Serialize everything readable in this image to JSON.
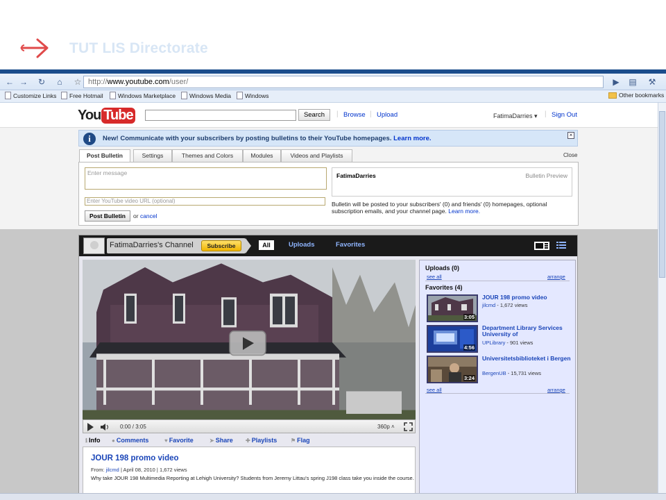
{
  "slide": {
    "title": "TUT LIS Directorate"
  },
  "browser": {
    "url_prefix": "http://",
    "url_domain": "www.youtube.com",
    "url_path": "/user/",
    "bookmarks": [
      "Customize Links",
      "Free Hotmail",
      "Windows Marketplace",
      "Windows Media",
      "Windows"
    ],
    "other_bookmarks": "Other bookmarks"
  },
  "yt": {
    "logo_you": "You",
    "logo_tube": "Tube",
    "search_label": "Search",
    "browse": "Browse",
    "upload": "Upload",
    "username": "FatimaDarries ▾",
    "sign_out": "Sign Out"
  },
  "notice": {
    "text": "New! Communicate with your subscribers by posting bulletins to their YouTube homepages.",
    "learn_more": "Learn more."
  },
  "tabs": [
    "Post Bulletin",
    "Settings",
    "Themes and Colors",
    "Modules",
    "Videos and Playlists"
  ],
  "close_label": "Close",
  "bulletin": {
    "message_placeholder": "Enter message",
    "url_placeholder": "Enter YouTube video URL (optional)",
    "post_button": "Post Bulletin",
    "or": "or",
    "cancel": "cancel",
    "preview_user": "FatimaDarries",
    "preview_label": "Bulletin Preview",
    "note": "Bulletin will be posted to your subscribers' (0) and friends' (0) homepages, optional subscription emails, and your channel page.",
    "note_link": "Learn more."
  },
  "channel": {
    "title": "FatimaDarries's Channel",
    "subscribe": "Subscribe",
    "tab_all": "All",
    "tab_uploads": "Uploads",
    "tab_favorites": "Favorites"
  },
  "player": {
    "time": "0:00 / 3:05",
    "quality": "360p ˄"
  },
  "video_tabs": [
    "Info",
    "Comments",
    "Favorite",
    "Share",
    "Playlists",
    "Flag"
  ],
  "video": {
    "title": "JOUR 198 promo video",
    "from_label": "From:",
    "from_user": "jilcmd",
    "meta_rest": " | April 08, 2010 | 1,672 views",
    "description": "Why take JOUR 198 Multimedia Reporting at Lehigh University? Students from Jeremy Littau's spring J198 class take you inside the course."
  },
  "side": {
    "uploads_heading": "Uploads (0)",
    "see_all": "see all",
    "arrange": "arrange",
    "favorites_heading": "Favorites (4)",
    "favorites": [
      {
        "title": "JOUR 198 promo video",
        "user": "jilcmd",
        "views": " - 1,672 views",
        "duration": "3:05"
      },
      {
        "title": "Department Library Services University of",
        "user": "UPLibrary",
        "views": " - 901 views",
        "duration": "4:56"
      },
      {
        "title": "Universitetsbiblioteket i Bergen",
        "user": "BergenUB",
        "views": " - 15,731 views",
        "duration": "3:24"
      }
    ]
  }
}
